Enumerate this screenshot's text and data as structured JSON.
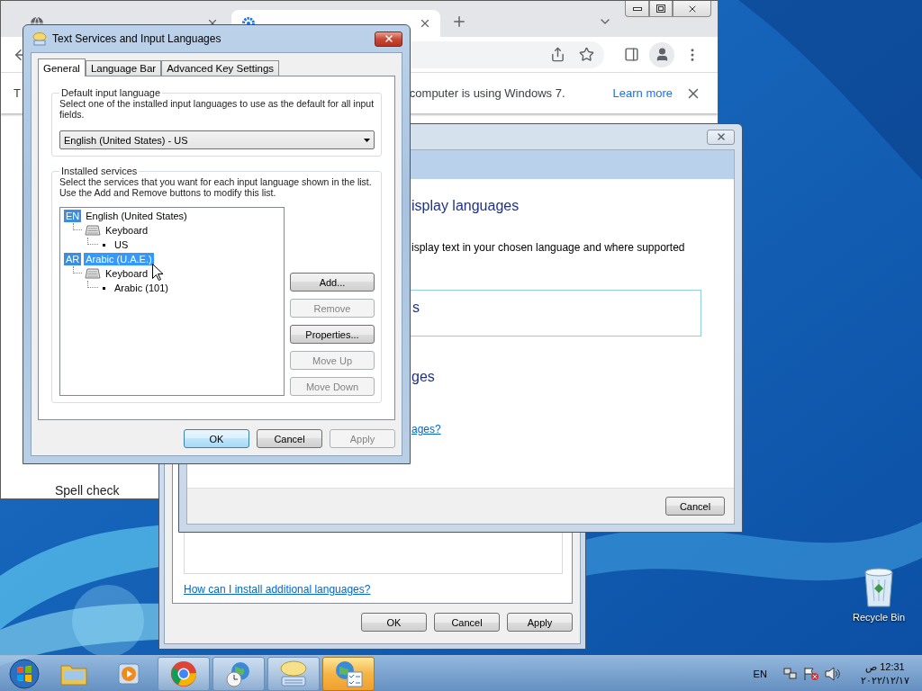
{
  "desktop": {
    "icons": [
      {
        "label": "Recycle Bin"
      }
    ]
  },
  "browser": {
    "tabs": [
      {
        "selected": false
      },
      {
        "selected": true
      }
    ],
    "notice": {
      "lead": "T",
      "text": "computer is using Windows 7.",
      "link": "Learn more"
    },
    "page_text": "Spell check"
  },
  "region_window": {
    "link": "How can I install additional languages?",
    "buttons": [
      {
        "label": "OK"
      },
      {
        "label": "Cancel"
      },
      {
        "label": "Apply"
      }
    ]
  },
  "display_window": {
    "heading": "isplay languages",
    "description": "isplay text in your chosen language and where supported",
    "box_text": "s",
    "subheading": "ges",
    "link": "ages?",
    "buttons": [
      {
        "label": "Cancel"
      }
    ]
  },
  "text_services_window": {
    "title": "Text Services and Input Languages",
    "tabs": [
      {
        "label": "General",
        "selected": true
      },
      {
        "label": "Language Bar",
        "selected": false
      },
      {
        "label": "Advanced Key Settings",
        "selected": false
      }
    ],
    "default_language": {
      "legend": "Default input language",
      "description": "Select one of the installed input languages to use as the default for all input fields.",
      "value": "English (United States) - US"
    },
    "installed_services": {
      "legend": "Installed services",
      "description": "Select the services that you want for each input language shown in the list. Use the Add and Remove buttons to modify this list.",
      "languages": [
        {
          "kind": "language",
          "badge": "EN",
          "label": "English (United States)",
          "selected": false,
          "children": [
            {
              "kind": "category",
              "label": "Keyboard",
              "selected": false,
              "children": [
                {
                  "kind": "layout",
                  "label": "US",
                  "selected": false
                }
              ]
            }
          ]
        },
        {
          "kind": "language",
          "badge": "AR",
          "label": "Arabic (U.A.E.)",
          "selected": true,
          "children": [
            {
              "kind": "category",
              "label": "Keyboard",
              "selected": false,
              "children": [
                {
                  "kind": "layout",
                  "label": "Arabic (101)",
                  "selected": false
                }
              ]
            }
          ]
        }
      ],
      "buttons": [
        {
          "label": "Add...",
          "disabled": false
        },
        {
          "label": "Remove",
          "disabled": true
        },
        {
          "label": "Properties...",
          "disabled": false
        },
        {
          "label": "Move Up",
          "disabled": true
        },
        {
          "label": "Move Down",
          "disabled": true
        }
      ]
    },
    "buttons": [
      {
        "label": "OK",
        "disabled": false,
        "default": true
      },
      {
        "label": "Cancel",
        "disabled": false,
        "default": false
      },
      {
        "label": "Apply",
        "disabled": true,
        "default": false
      }
    ]
  },
  "taskbar": {
    "items": [
      {
        "kind": "start",
        "running": false,
        "selected": false
      },
      {
        "kind": "folder",
        "running": false,
        "selected": false
      },
      {
        "kind": "media",
        "running": false,
        "selected": false
      },
      {
        "kind": "chrome",
        "running": true,
        "selected": false
      },
      {
        "kind": "globe-clock",
        "running": true,
        "selected": false
      },
      {
        "kind": "speech",
        "running": true,
        "selected": false
      },
      {
        "kind": "globe-list",
        "running": true,
        "selected": true
      }
    ],
    "tray": {
      "language": "EN",
      "time": "12:31 ص",
      "date": "٢٠٢٢/١٢/١٧"
    }
  }
}
